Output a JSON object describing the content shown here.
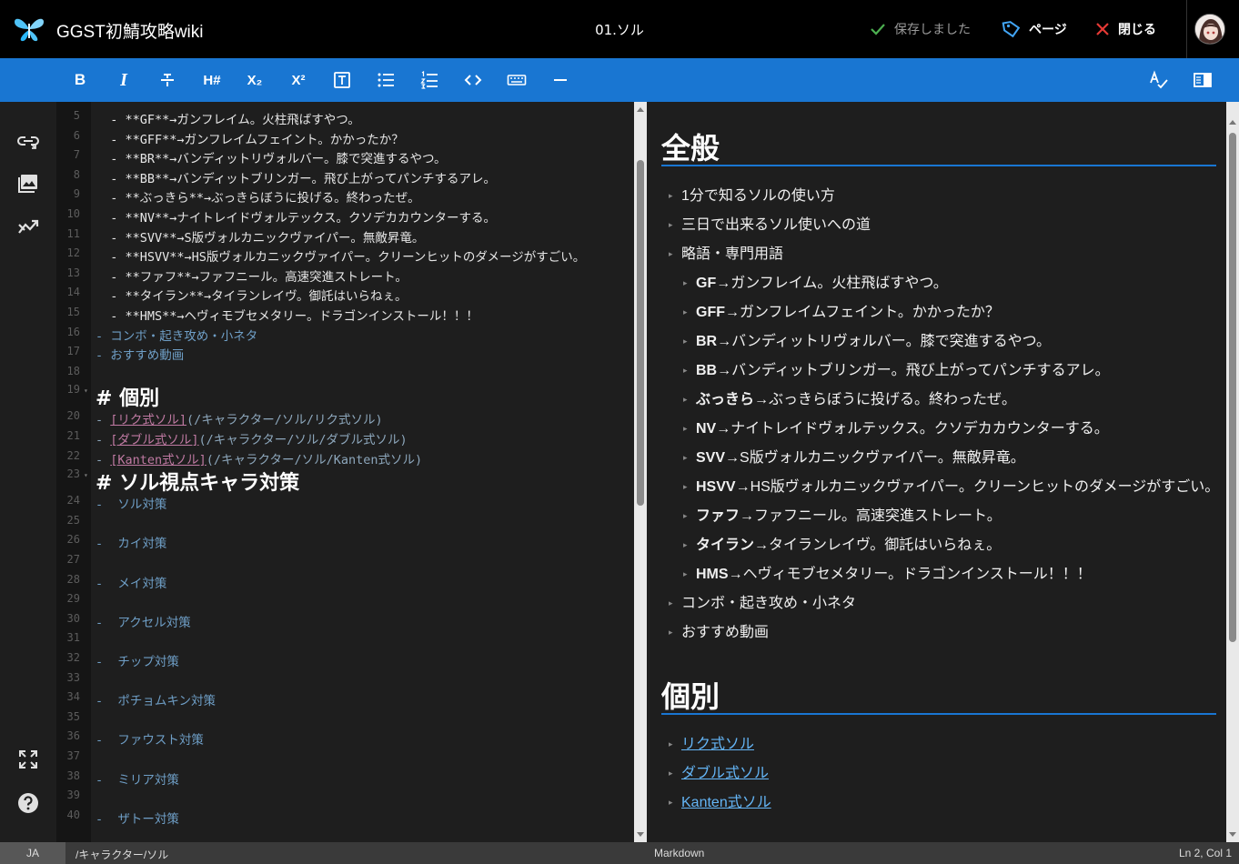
{
  "header": {
    "app_title": "GGST初鯖攻略wiki",
    "page_name": "01.ソル",
    "saved_label": "保存しました",
    "page_label": "ページ",
    "close_label": "閉じる"
  },
  "toolbar": {
    "bold": "B",
    "italic": "I",
    "heading": "H#",
    "subscript": "X₂",
    "superscript": "X²"
  },
  "editor": {
    "lines": [
      {
        "n": "5",
        "text": "  - **GF**→ガンフレイム。火柱飛ばすやつ。"
      },
      {
        "n": "6",
        "text": "  - **GFF**→ガンフレイムフェイント。かかったか？"
      },
      {
        "n": "7",
        "text": "  - **BR**→バンディットリヴォルバー。膝で突進するやつ。"
      },
      {
        "n": "8",
        "text": "  - **BB**→バンディットブリンガー。飛び上がってパンチするアレ。"
      },
      {
        "n": "9",
        "text": "  - **ぶっきら**→ぶっきらぼうに投げる。終わったぜ。"
      },
      {
        "n": "10",
        "text": "  - **NV**→ナイトレイドヴォルテックス。クソデカカウンターする。"
      },
      {
        "n": "11",
        "text": "  - **SVV**→S版ヴォルカニックヴァイパー。無敵昇竜。"
      },
      {
        "n": "12",
        "text": "  - **HSVV**→HS版ヴォルカニックヴァイパー。クリーンヒットのダメージがすごい。"
      },
      {
        "n": "13",
        "text": "  - **ファフ**→ファフニール。高速突進ストレート。"
      },
      {
        "n": "14",
        "text": "  - **タイラン**→タイランレイヴ。御託はいらねぇ。"
      },
      {
        "n": "15",
        "text": "  - **HMS**→ヘヴィモブセメタリー。ドラゴンインストール！！！"
      },
      {
        "n": "16",
        "text": "- コンボ・起き攻め・小ネタ"
      },
      {
        "n": "17",
        "text": "- おすすめ動画"
      },
      {
        "n": "18",
        "text": ""
      },
      {
        "n": "19",
        "text": "# 個別"
      },
      {
        "n": "20",
        "link": "[リク式ソル]",
        "url": "(/キャラクター/ソル/リク式ソル)"
      },
      {
        "n": "21",
        "link": "[ダブル式ソル]",
        "url": "(/キャラクター/ソル/ダブル式ソル)"
      },
      {
        "n": "22",
        "link": "[Kanten式ソル]",
        "url": "(/キャラクター/ソル/Kanten式ソル)"
      },
      {
        "n": "23",
        "text": "# ソル視点キャラ対策"
      },
      {
        "n": "24",
        "text": "-  ソル対策"
      },
      {
        "n": "25",
        "text": ""
      },
      {
        "n": "26",
        "text": "-  カイ対策"
      },
      {
        "n": "27",
        "text": ""
      },
      {
        "n": "28",
        "text": "-  メイ対策"
      },
      {
        "n": "29",
        "text": ""
      },
      {
        "n": "30",
        "text": "-  アクセル対策"
      },
      {
        "n": "31",
        "text": ""
      },
      {
        "n": "32",
        "text": "-  チップ対策"
      },
      {
        "n": "33",
        "text": ""
      },
      {
        "n": "34",
        "text": "-  ポチョムキン対策"
      },
      {
        "n": "35",
        "text": ""
      },
      {
        "n": "36",
        "text": "-  ファウスト対策"
      },
      {
        "n": "37",
        "text": ""
      },
      {
        "n": "38",
        "text": "-  ミリア対策"
      },
      {
        "n": "39",
        "text": ""
      },
      {
        "n": "40",
        "text": "-  ザトー対策"
      }
    ]
  },
  "preview": {
    "sections": [
      {
        "heading": "全般",
        "items": [
          {
            "level": 1,
            "text": "1分で知るソルの使い方"
          },
          {
            "level": 1,
            "text": "三日で出来るソル使いへの道"
          },
          {
            "level": 1,
            "text": "略語・専門用語"
          },
          {
            "level": 2,
            "bold": "GF",
            "text": "→ガンフレイム。火柱飛ばすやつ。"
          },
          {
            "level": 2,
            "bold": "GFF",
            "text": "→ガンフレイムフェイント。かかったか？"
          },
          {
            "level": 2,
            "bold": "BR",
            "text": "→バンディットリヴォルバー。膝で突進するやつ。"
          },
          {
            "level": 2,
            "bold": "BB",
            "text": "→バンディットブリンガー。飛び上がってパンチするアレ。"
          },
          {
            "level": 2,
            "bold": "ぶっきら",
            "text": "→ぶっきらぼうに投げる。終わったぜ。"
          },
          {
            "level": 2,
            "bold": "NV",
            "text": "→ナイトレイドヴォルテックス。クソデカカウンターする。"
          },
          {
            "level": 2,
            "bold": "SVV",
            "text": "→S版ヴォルカニックヴァイパー。無敵昇竜。"
          },
          {
            "level": 2,
            "bold": "HSVV",
            "text": "→HS版ヴォルカニックヴァイパー。クリーンヒットのダメージがすごい。"
          },
          {
            "level": 2,
            "bold": "ファフ",
            "text": "→ファフニール。高速突進ストレート。"
          },
          {
            "level": 2,
            "bold": "タイラン",
            "text": "→タイランレイヴ。御託はいらねぇ。"
          },
          {
            "level": 2,
            "bold": "HMS",
            "text": "→ヘヴィモブセメタリー。ドラゴンインストール！！！"
          },
          {
            "level": 1,
            "text": "コンボ・起き攻め・小ネタ"
          },
          {
            "level": 1,
            "text": "おすすめ動画"
          }
        ]
      },
      {
        "heading": "個別",
        "items": [
          {
            "level": 1,
            "link": "リク式ソル"
          },
          {
            "level": 1,
            "link": "ダブル式ソル"
          },
          {
            "level": 1,
            "link": "Kanten式ソル"
          }
        ]
      }
    ]
  },
  "status": {
    "lang": "JA",
    "path": "/キャラクター/ソル",
    "mode": "Markdown",
    "position": "Ln 2, Col 1"
  },
  "colors": {
    "toolbar": "#1976d2",
    "link": "#64b5f6",
    "saved_check": "#4caf50",
    "close_x": "#e53935"
  }
}
